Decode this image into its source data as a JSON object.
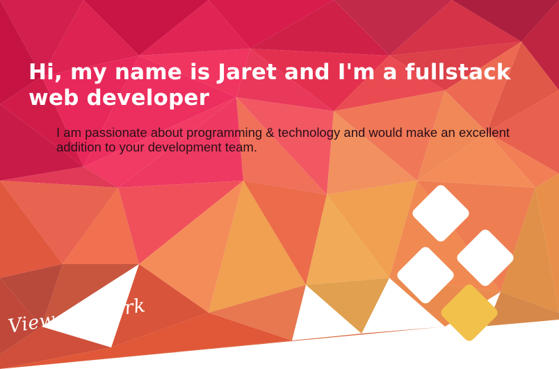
{
  "hero": {
    "headline": "Hi, my name is Jaret and I'm a fullstack web developer",
    "intro": "I am passionate about programming & technology and would make an excellent addition to your development team.",
    "cta_label": "View my work"
  },
  "logo": {
    "icon": "diamond-tiles-icon"
  },
  "colors": {
    "crimson": "#c8174a",
    "pink": "#e8285a",
    "coral": "#ef6a52",
    "orange": "#f08a52",
    "amber": "#f0a050",
    "tile_white": "#ffffff",
    "tile_yellow": "#f2c14b"
  }
}
